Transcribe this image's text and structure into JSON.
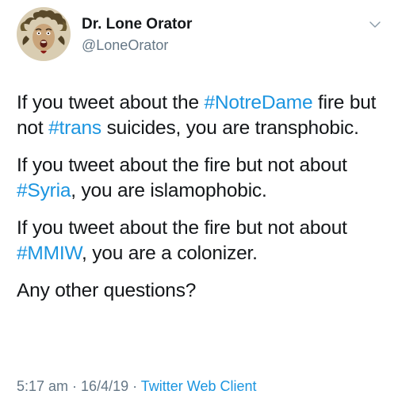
{
  "author": {
    "display_name": "Dr. Lone Orator",
    "handle": "@LoneOrator"
  },
  "tweet": {
    "paragraphs": [
      [
        {
          "text": "If you tweet about the ",
          "type": "text"
        },
        {
          "text": "#NotreDame",
          "type": "hashtag"
        },
        {
          "text": " fire but not ",
          "type": "text"
        },
        {
          "text": "#trans",
          "type": "hashtag"
        },
        {
          "text": " suicides, you are transphobic.",
          "type": "text"
        }
      ],
      [
        {
          "text": "If you tweet about the fire but not about ",
          "type": "text"
        },
        {
          "text": "#Syria",
          "type": "hashtag"
        },
        {
          "text": ", you are islamophobic.",
          "type": "text"
        }
      ],
      [
        {
          "text": "If you tweet about the fire but not about ",
          "type": "text"
        },
        {
          "text": "#MMIW",
          "type": "hashtag"
        },
        {
          "text": ", you are a colonizer.",
          "type": "text"
        }
      ],
      [
        {
          "text": "Any other questions?",
          "type": "text"
        }
      ]
    ]
  },
  "meta": {
    "time": "5:17 am",
    "separator1": " · ",
    "date": "16/4/19",
    "separator2": " · ",
    "client": "Twitter Web Client"
  },
  "icons": {
    "avatar": "medusa-avatar",
    "menu": "chevron-down-icon"
  },
  "colors": {
    "text": "#14171a",
    "secondary": "#657786",
    "link": "#1b95e0",
    "background": "#ffffff"
  }
}
